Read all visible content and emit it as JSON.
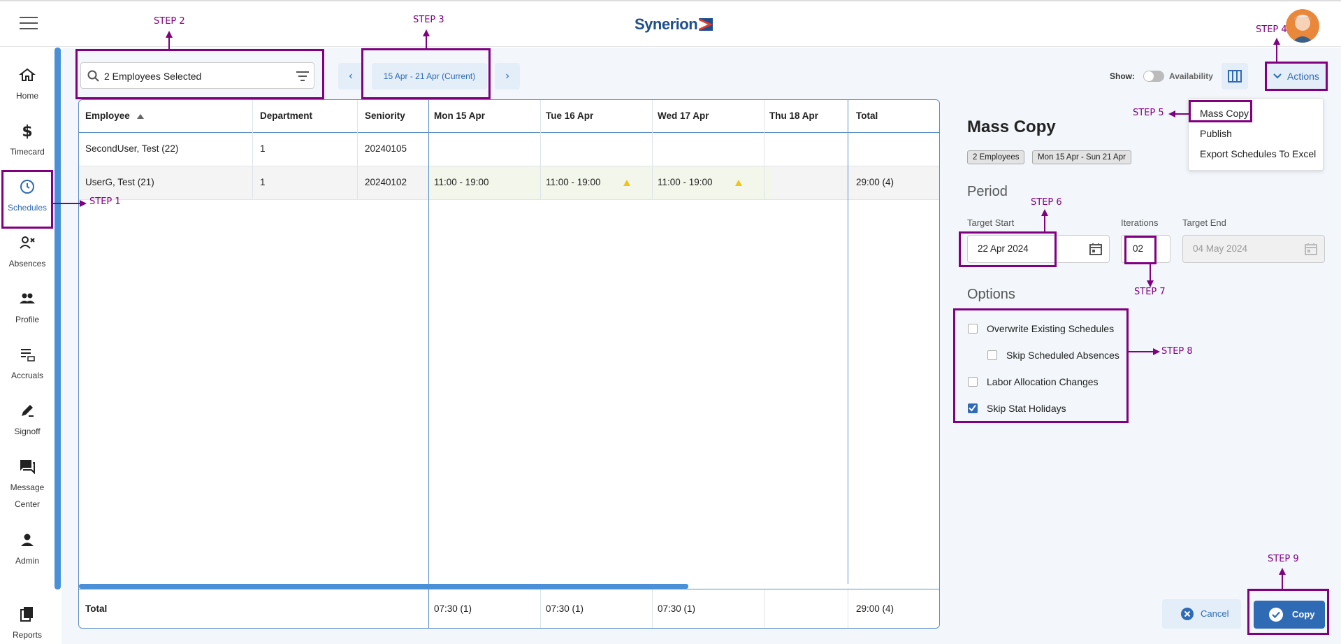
{
  "header": {
    "brand": "Synerion"
  },
  "sidebar": {
    "items": [
      {
        "label": "Home",
        "icon": "home-icon"
      },
      {
        "label": "Timecard",
        "icon": "dollar-icon"
      },
      {
        "label": "Schedules",
        "icon": "clock-icon"
      },
      {
        "label": "Absences",
        "icon": "person-remove-icon"
      },
      {
        "label": "Profile",
        "icon": "people-icon"
      },
      {
        "label": "Accruals",
        "icon": "list-bank-icon"
      },
      {
        "label": "Signoff",
        "icon": "pen-icon"
      },
      {
        "label": "Message",
        "label2": "Center",
        "icon": "chat-icon"
      },
      {
        "label": "Admin",
        "icon": "person-icon"
      },
      {
        "label": "Reports",
        "icon": "documents-icon"
      }
    ]
  },
  "toolbar": {
    "employee_filter": "2 Employees Selected",
    "date_range": "15 Apr - 21 Apr (Current)",
    "show_label": "Show:",
    "availability_label": "Availability",
    "actions_label": "Actions"
  },
  "grid": {
    "columns": [
      "Employee",
      "Department",
      "Seniority",
      "Mon 15 Apr",
      "Tue 16 Apr",
      "Wed 17 Apr",
      "Thu 18 Apr",
      "Total"
    ],
    "rows": [
      {
        "employee": "SecondUser, Test (22)",
        "department": "1",
        "seniority": "20240105",
        "mon": "",
        "tue": "",
        "wed": "",
        "thu": "",
        "total": ""
      },
      {
        "employee": "UserG, Test (21)",
        "department": "1",
        "seniority": "20240102",
        "mon": "11:00 - 19:00",
        "tue": "11:00 - 19:00",
        "wed": "11:00 - 19:00",
        "thu": "",
        "total": "29:00 (4)"
      }
    ],
    "footer": {
      "label": "Total",
      "mon": "07:30 (1)",
      "tue": "07:30 (1)",
      "wed": "07:30 (1)",
      "thu": "",
      "total": "29:00 (4)"
    }
  },
  "actions_menu": {
    "items": [
      "Mass Copy",
      "Publish",
      "Export Schedules To Excel"
    ]
  },
  "mass_copy": {
    "title": "Mass Copy",
    "chips": [
      "2 Employees",
      "Mon 15 Apr - Sun 21 Apr"
    ],
    "period_title": "Period",
    "target_start_label": "Target Start",
    "target_start_value": "22 Apr 2024",
    "iterations_label": "Iterations",
    "iterations_value": "02",
    "target_end_label": "Target End",
    "target_end_value": "04 May 2024",
    "options_title": "Options",
    "options": [
      {
        "label": "Overwrite Existing Schedules",
        "checked": false
      },
      {
        "label": "Skip Scheduled Absences",
        "checked": false
      },
      {
        "label": "Labor Allocation Changes",
        "checked": false
      },
      {
        "label": "Skip Stat Holidays",
        "checked": true
      }
    ],
    "cancel_label": "Cancel",
    "copy_label": "Copy"
  },
  "annotations": [
    "STEP 1",
    "STEP 2",
    "STEP 3",
    "STEP 4",
    "STEP 5",
    "STEP 6",
    "STEP 7",
    "STEP 8",
    "STEP 9"
  ],
  "colors": {
    "accent": "#2f6bb5",
    "annotation": "#800080",
    "shift_bg": "#f3f6ea",
    "warning": "#f0c419"
  }
}
